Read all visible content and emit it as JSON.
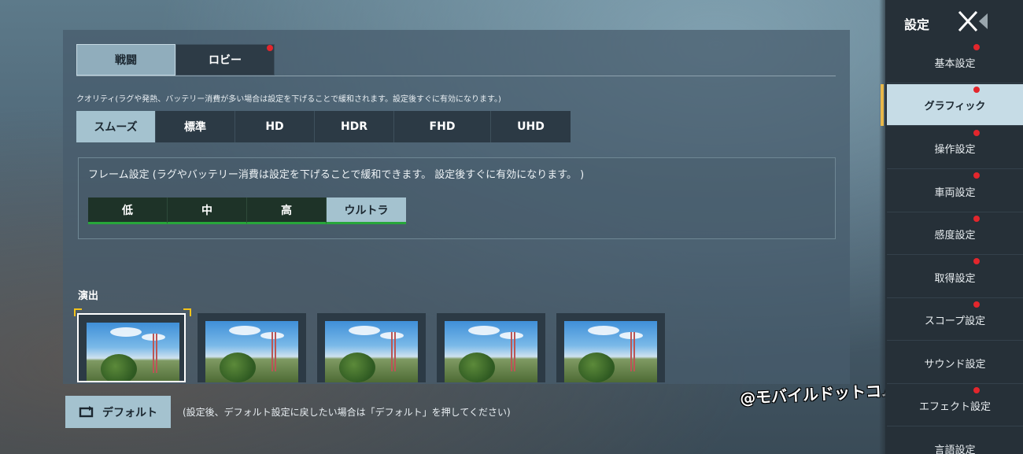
{
  "tabs": [
    {
      "label": "戦闘",
      "active": true
    },
    {
      "label": "ロビー",
      "active": false,
      "badge": true
    }
  ],
  "quality": {
    "note": "クオリティ(ラグや発熱、バッテリー消費が多い場合は設定を下げることで緩和されます。設定後すぐに有効になります。)",
    "options": [
      "スムーズ",
      "標準",
      "HD",
      "HDR",
      "FHD",
      "UHD"
    ],
    "selected": "スムーズ"
  },
  "frame": {
    "note": "フレーム設定 (ラグやバッテリー消費は設定を下げることで緩和できます。 設定後すぐに有効になります。 )",
    "options": [
      "低",
      "中",
      "高",
      "ウルトラ"
    ],
    "selected": "ウルトラ"
  },
  "effects": {
    "label": "演出",
    "thumbnail_count": 5,
    "selected_index": 0
  },
  "footer": {
    "default_label": "デフォルト",
    "default_note": "(設定後、デフォルト設定に戻したい場合は「デフォルト」を押してください)"
  },
  "watermark": "@モバイルドットコム",
  "sidebar": {
    "title": "設定",
    "items": [
      {
        "label": "基本設定",
        "badge": true
      },
      {
        "label": "グラフィック",
        "badge": true,
        "active": true
      },
      {
        "label": "操作設定",
        "badge": true
      },
      {
        "label": "車両設定",
        "badge": true
      },
      {
        "label": "感度設定",
        "badge": true
      },
      {
        "label": "取得設定",
        "badge": true
      },
      {
        "label": "スコープ設定",
        "badge": true
      },
      {
        "label": "サウンド設定",
        "badge": false
      },
      {
        "label": "エフェクト設定",
        "badge": true
      },
      {
        "label": "言語設定",
        "badge": false
      }
    ]
  },
  "colors": {
    "accent_selected": "#a4c2cf",
    "badge_red": "#e3262c",
    "frame_green": "#27a63a",
    "selection_gold": "#f2c21b"
  }
}
